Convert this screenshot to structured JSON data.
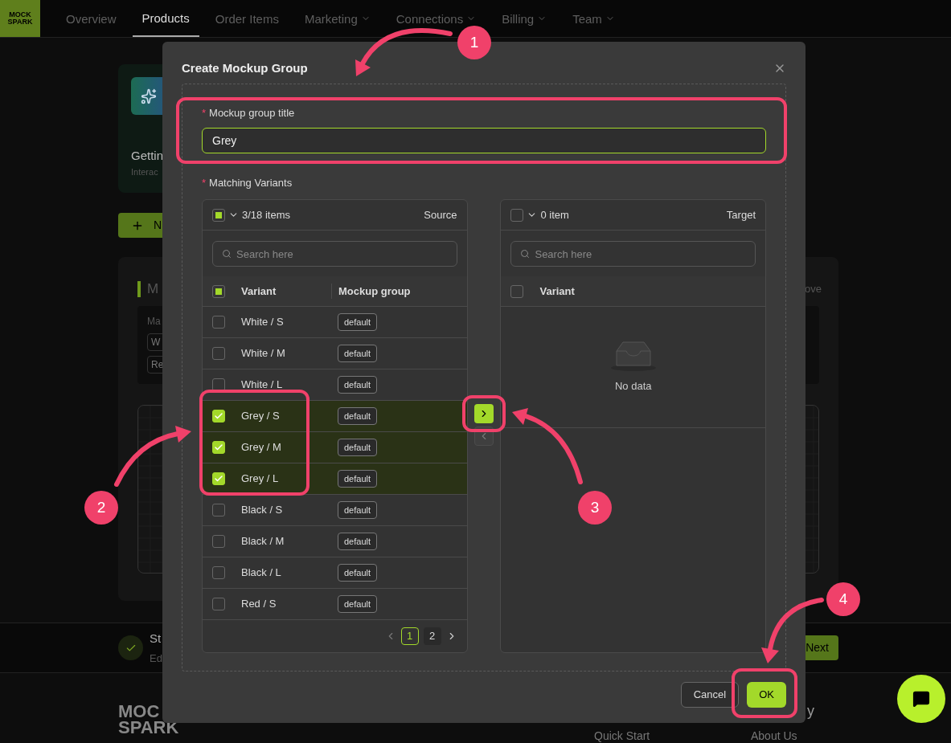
{
  "nav": {
    "logo": [
      "MOCK",
      "SPARK"
    ],
    "items": [
      {
        "label": "Overview",
        "selected": false,
        "dropdown": false
      },
      {
        "label": "Products",
        "selected": true,
        "dropdown": false
      },
      {
        "label": "Order Items",
        "selected": false,
        "dropdown": false
      },
      {
        "label": "Marketing",
        "selected": false,
        "dropdown": true
      },
      {
        "label": "Connections",
        "selected": false,
        "dropdown": true
      },
      {
        "label": "Billing",
        "selected": false,
        "dropdown": true
      },
      {
        "label": "Team",
        "selected": false,
        "dropdown": true
      }
    ]
  },
  "background": {
    "card": {
      "title": "Gettin",
      "subtitle": "Interac"
    },
    "new_button": "N",
    "section": {
      "title": "M",
      "action": "ove",
      "filter_label": "Ma",
      "tags": [
        "W",
        "Re"
      ]
    },
    "step": {
      "title": "St",
      "subtitle": "Ed",
      "done": true,
      "next_button": "Next"
    },
    "footer": {
      "logo": [
        "MOC",
        "SPARK"
      ],
      "heading": "y",
      "links": [
        "Quick Start",
        "About Us"
      ]
    }
  },
  "dialog": {
    "title": "Create Mockup Group",
    "title_field": {
      "required_mark": "*",
      "label": "Mockup group title",
      "value": "Grey"
    },
    "variants_required_mark": "*",
    "variants_label": "Matching Variants",
    "source": {
      "select_all": {
        "indeterminate": true
      },
      "count": "3/18 items",
      "title": "Source",
      "search_placeholder": "Search here",
      "columns": [
        "Variant",
        "Mockup group"
      ],
      "header_checkbox": {
        "indeterminate": true
      },
      "rows": [
        {
          "variant": "White / S",
          "group": "default",
          "checked": false
        },
        {
          "variant": "White / M",
          "group": "default",
          "checked": false
        },
        {
          "variant": "White / L",
          "group": "default",
          "checked": false
        },
        {
          "variant": "Grey / S",
          "group": "default",
          "checked": true
        },
        {
          "variant": "Grey / M",
          "group": "default",
          "checked": true
        },
        {
          "variant": "Grey / L",
          "group": "default",
          "checked": true
        },
        {
          "variant": "Black / S",
          "group": "default",
          "checked": false
        },
        {
          "variant": "Black / M",
          "group": "default",
          "checked": false
        },
        {
          "variant": "Black / L",
          "group": "default",
          "checked": false
        },
        {
          "variant": "Red / S",
          "group": "default",
          "checked": false
        }
      ],
      "pages": [
        {
          "label": "1",
          "selected": true
        },
        {
          "label": "2",
          "selected": false
        }
      ]
    },
    "transfer_buttons": [
      {
        "kind": "right",
        "disabled": false
      },
      {
        "kind": "left",
        "disabled": true
      }
    ],
    "target": {
      "select_all": {
        "indeterminate": false
      },
      "count": "0 item",
      "title": "Target",
      "search_placeholder": "Search here",
      "columns": [
        "Variant"
      ],
      "header_checkbox": {
        "indeterminate": false
      },
      "empty_text": "No data"
    },
    "buttons": [
      {
        "label": "Cancel",
        "primary": false
      },
      {
        "label": "OK",
        "primary": true
      }
    ]
  },
  "annotations": [
    {
      "number": "1"
    },
    {
      "number": "2"
    },
    {
      "number": "3"
    },
    {
      "number": "4"
    }
  ]
}
